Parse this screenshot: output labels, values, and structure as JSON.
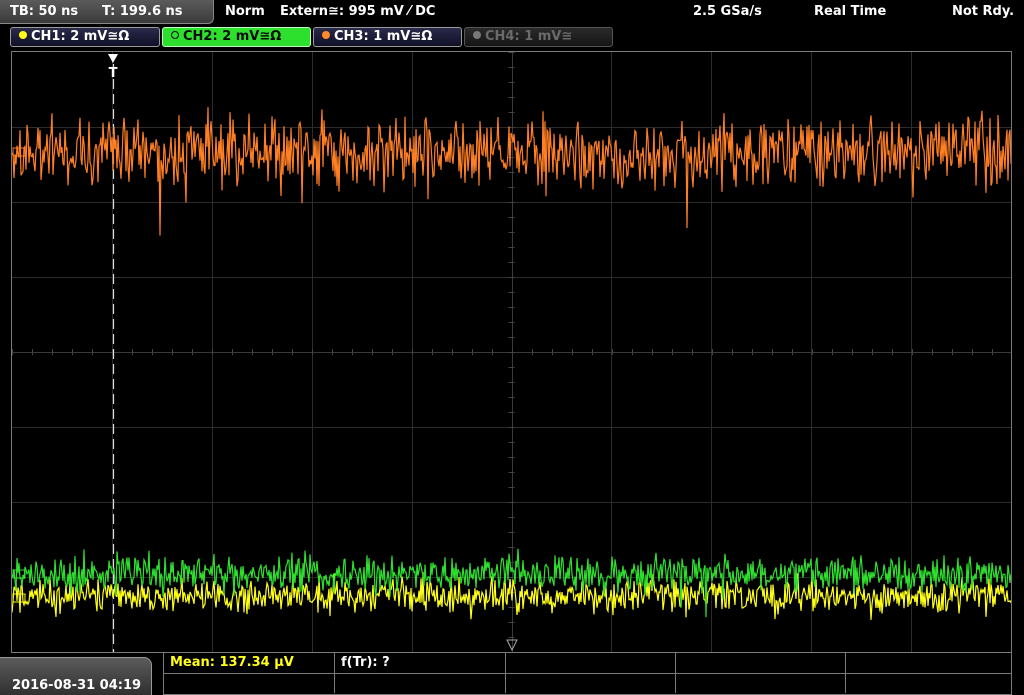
{
  "status": {
    "timebase": "TB: 50 ns",
    "trigger_time": "T: 199.6 ns",
    "mode": "Norm",
    "trigger_source": "Extern≅: 995 mV ⁄ DC",
    "sample_rate": "2.5 GSa/s",
    "acq_mode": "Real Time",
    "state": "Not Rdy."
  },
  "channels": [
    {
      "label": "CH1: 2 mV≅Ω",
      "color": "#ffff1a",
      "state": "normal"
    },
    {
      "label": "CH2: 2 mV≅Ω",
      "color": "#22e022",
      "state": "active"
    },
    {
      "label": "CH3: 1 mV≅Ω",
      "color": "#ff8a2a",
      "state": "normal"
    },
    {
      "label": "CH4: 1 mV≅",
      "color": "#777777",
      "state": "dim"
    }
  ],
  "trigger_marker": "T",
  "trace_colors": {
    "ch1": "#ffff1a",
    "ch2": "#2ee02e",
    "ch3": "#ff7f24"
  },
  "measurements": {
    "mean": "Mean: 137.34 µV",
    "ftr": "f(Tr): ?"
  },
  "datetime": "2016-08-31 04:19"
}
